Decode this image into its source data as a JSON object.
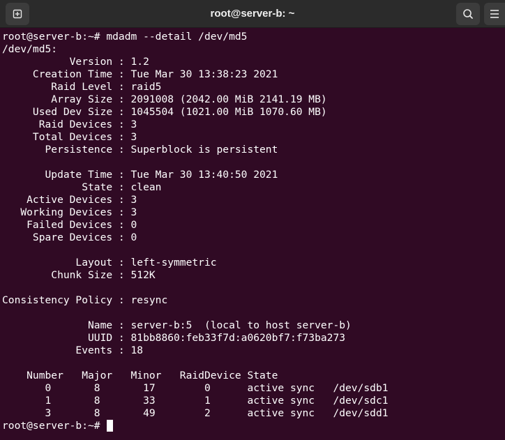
{
  "window": {
    "title": "root@server-b: ~"
  },
  "icons": {
    "new_tab": "new-tab-icon",
    "search": "search-icon",
    "menu": "hamburger-menu-icon"
  },
  "colors": {
    "terminal_background": "#300a24",
    "titlebar_background": "#2b2b2b",
    "text": "#ffffff"
  },
  "terminal": {
    "lines": [
      "root@server-b:~# mdadm --detail /dev/md5",
      "/dev/md5:",
      "           Version : 1.2",
      "     Creation Time : Tue Mar 30 13:38:23 2021",
      "        Raid Level : raid5",
      "        Array Size : 2091008 (2042.00 MiB 2141.19 MB)",
      "     Used Dev Size : 1045504 (1021.00 MiB 1070.60 MB)",
      "      Raid Devices : 3",
      "     Total Devices : 3",
      "       Persistence : Superblock is persistent",
      "",
      "       Update Time : Tue Mar 30 13:40:50 2021",
      "             State : clean",
      "    Active Devices : 3",
      "   Working Devices : 3",
      "    Failed Devices : 0",
      "     Spare Devices : 0",
      "",
      "            Layout : left-symmetric",
      "        Chunk Size : 512K",
      "",
      "Consistency Policy : resync",
      "",
      "              Name : server-b:5  (local to host server-b)",
      "              UUID : 81bb8860:feb33f7d:a0620bf7:f73ba273",
      "            Events : 18",
      "",
      "    Number   Major   Minor   RaidDevice State",
      "       0       8       17        0      active sync   /dev/sdb1",
      "       1       8       33        1      active sync   /dev/sdc1",
      "       3       8       49        2      active sync   /dev/sdd1"
    ],
    "prompt": "root@server-b:~# "
  }
}
